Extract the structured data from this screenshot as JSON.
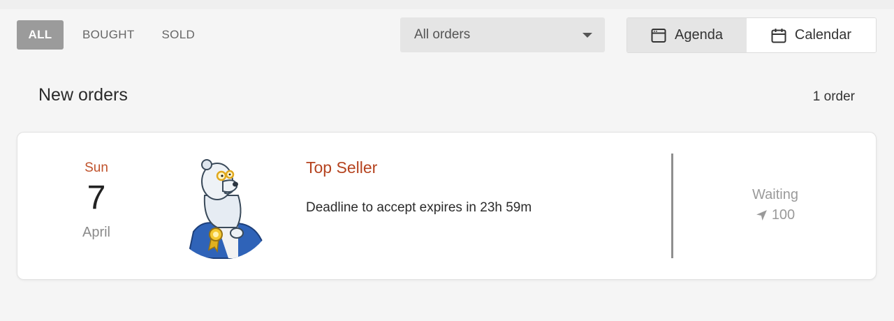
{
  "filters": {
    "tabs": [
      {
        "label": "ALL",
        "active": true
      },
      {
        "label": "BOUGHT",
        "active": false
      },
      {
        "label": "SOLD",
        "active": false
      }
    ]
  },
  "order_filter": {
    "selected": "All orders"
  },
  "view_toggle": {
    "agenda_label": "Agenda",
    "calendar_label": "Calendar",
    "active": "Agenda"
  },
  "section": {
    "title": "New orders",
    "count": "1 order"
  },
  "orders": [
    {
      "weekday": "Sun",
      "day": "7",
      "month": "April",
      "seller": "Top Seller",
      "deadline": "Deadline to accept expires in 23h 59m",
      "status": "Waiting",
      "points": "100",
      "points_icon": "navigation-arrow-icon",
      "avatar_icon": "polar-bear-mascot"
    }
  ],
  "colors": {
    "accent": "#b5431f",
    "weekday": "#c0522b",
    "tab_active_bg": "#9b9b9b",
    "muted": "#9a9a9a"
  }
}
